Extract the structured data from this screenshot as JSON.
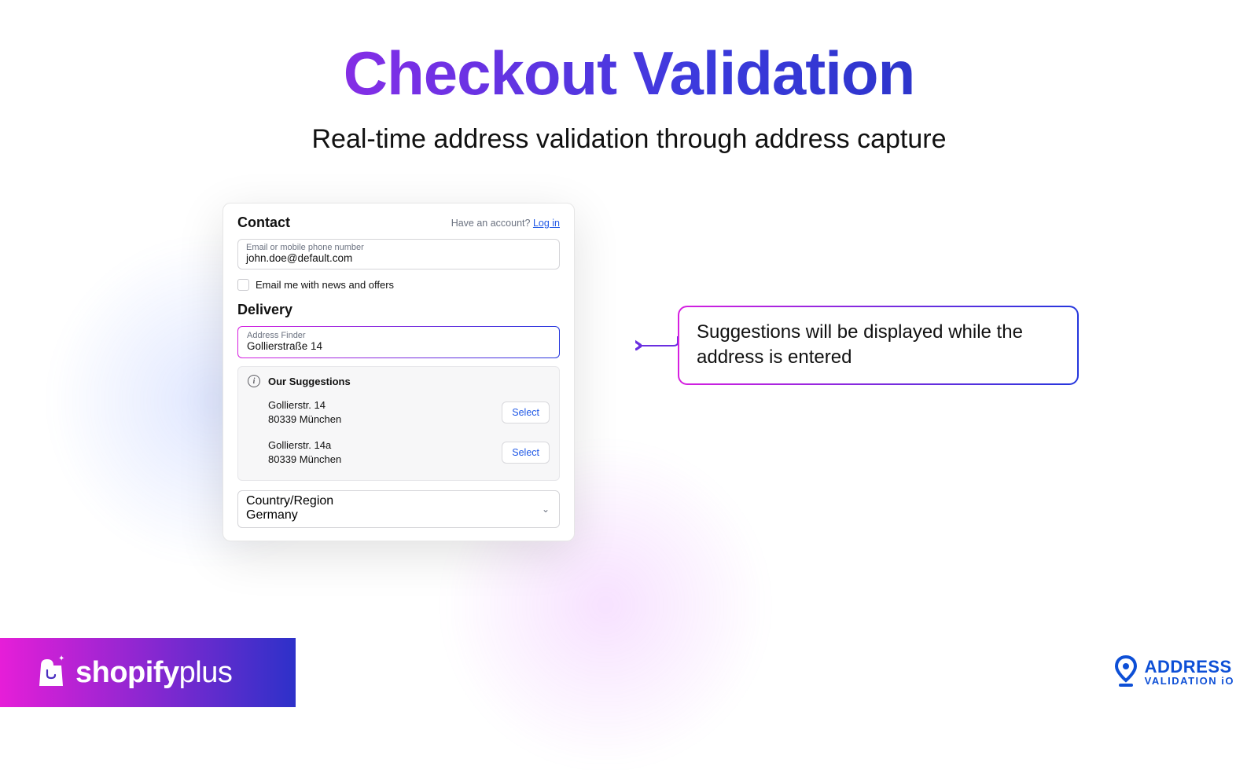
{
  "hero": {
    "title": "Checkout Validation",
    "subtitle": "Real-time address validation through address capture"
  },
  "checkout": {
    "contact_heading": "Contact",
    "have_account": "Have an account?",
    "login_link": "Log in",
    "email_placeholder": "Email or mobile phone number",
    "email_value": "john.doe@default.com",
    "newsletter_label": "Email me with news and offers",
    "delivery_heading": "Delivery",
    "finder_label": "Address Finder",
    "finder_value": "Gollierstraße 14",
    "suggestions_label": "Our Suggestions",
    "suggestions": [
      {
        "line1": "Gollierstr. 14",
        "line2": "80339 München",
        "button": "Select"
      },
      {
        "line1": "Gollierstr. 14a",
        "line2": "80339 München",
        "button": "Select"
      }
    ],
    "country_label": "Country/Region",
    "country_value": "Germany"
  },
  "callout": {
    "text": "Suggestions will be displayed while the address is entered"
  },
  "footer": {
    "shopify_plus_brand_a": "shopify",
    "shopify_plus_brand_b": "plus",
    "avio_brand_line1": "ADDRESS",
    "avio_brand_line2": "VALIDATION iO"
  }
}
